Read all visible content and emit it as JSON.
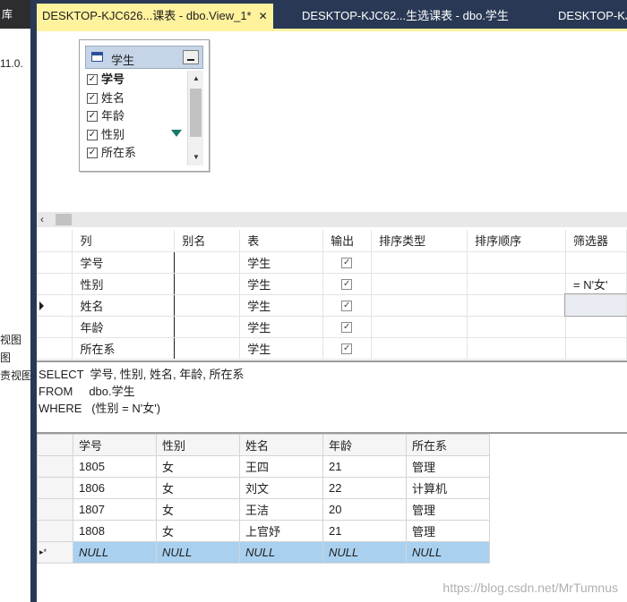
{
  "left_panel": {
    "top_label": "库",
    "version_text": "11.0.",
    "items": [
      "视图",
      "图",
      "责视图"
    ]
  },
  "tabs": [
    {
      "label": "DESKTOP-KJC626...课表 - dbo.View_1*",
      "close": "✕",
      "active": true
    },
    {
      "label": "DESKTOP-KJC62...生选课表 - dbo.学生",
      "active": false
    },
    {
      "label": "DESKTOP-KJ",
      "active": false
    }
  ],
  "diagram": {
    "table_title": "学生",
    "columns": [
      {
        "name": "学号",
        "checked": true,
        "bold": true
      },
      {
        "name": "姓名",
        "checked": true,
        "bold": false
      },
      {
        "name": "年龄",
        "checked": true,
        "bold": false
      },
      {
        "name": "性别",
        "checked": true,
        "bold": false,
        "filter": true
      },
      {
        "name": "所在系",
        "checked": true,
        "bold": false
      }
    ]
  },
  "criteria": {
    "headers": [
      "列",
      "别名",
      "表",
      "输出",
      "排序类型",
      "排序顺序",
      "筛选器"
    ],
    "rows": [
      {
        "column": "学号",
        "alias": "",
        "table": "学生",
        "output": true,
        "filter": ""
      },
      {
        "column": "性别",
        "alias": "",
        "table": "学生",
        "output": true,
        "filter": "= N'女'"
      },
      {
        "column": "姓名",
        "alias": "",
        "table": "学生",
        "output": true,
        "filter": "",
        "current": true
      },
      {
        "column": "年龄",
        "alias": "",
        "table": "学生",
        "output": true,
        "filter": ""
      },
      {
        "column": "所在系",
        "alias": "",
        "table": "学生",
        "output": true,
        "filter": ""
      }
    ]
  },
  "sql": {
    "line1": "SELECT  学号, 性别, 姓名, 年龄, 所在系",
    "line2": "FROM     dbo.学生",
    "line3": "WHERE   (性别 = N'女')"
  },
  "results": {
    "headers": [
      "学号",
      "性别",
      "姓名",
      "年龄",
      "所在系"
    ],
    "rows": [
      [
        "1805",
        "女",
        "王四",
        "21",
        "管理"
      ],
      [
        "1806",
        "女",
        "刘文",
        "22",
        "计算机"
      ],
      [
        "1807",
        "女",
        "王洁",
        "20",
        "管理"
      ],
      [
        "1808",
        "女",
        "上官妤",
        "21",
        "管理"
      ]
    ],
    "new_row": [
      "NULL",
      "NULL",
      "NULL",
      "NULL",
      "NULL"
    ],
    "new_row_marker": "▸*"
  },
  "watermark": "https://blog.csdn.net/MrTumnus",
  "colors": {
    "tab_bar": "#293955",
    "active_tab": "#fff29d",
    "new_row": "#a9d0ef"
  }
}
